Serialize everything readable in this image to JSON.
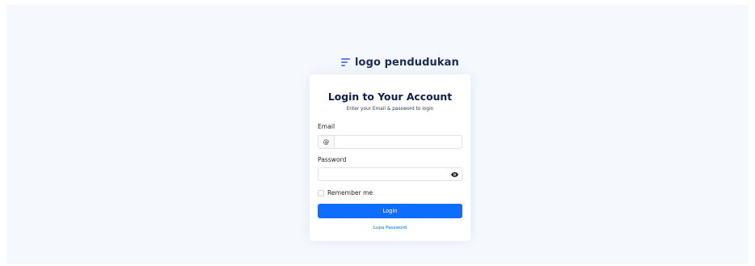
{
  "logo": {
    "text": "logo pendudukan",
    "icon": "menu-lines-icon",
    "icon_color": "#5c7cfa"
  },
  "login": {
    "title": "Login to Your Account",
    "subtitle": "Enter your Email & password to login",
    "email_label": "Email",
    "email_prefix": "@",
    "email_value": "",
    "password_label": "Password",
    "password_value": "",
    "password_toggle_icon": "eye-icon",
    "remember_label": "Remember me",
    "remember_checked": false,
    "submit_label": "Login",
    "forgot_label": "Lupa Password"
  },
  "colors": {
    "background": "#f5f8fd",
    "primary": "#0d6efd",
    "title": "#0d1f4d"
  }
}
